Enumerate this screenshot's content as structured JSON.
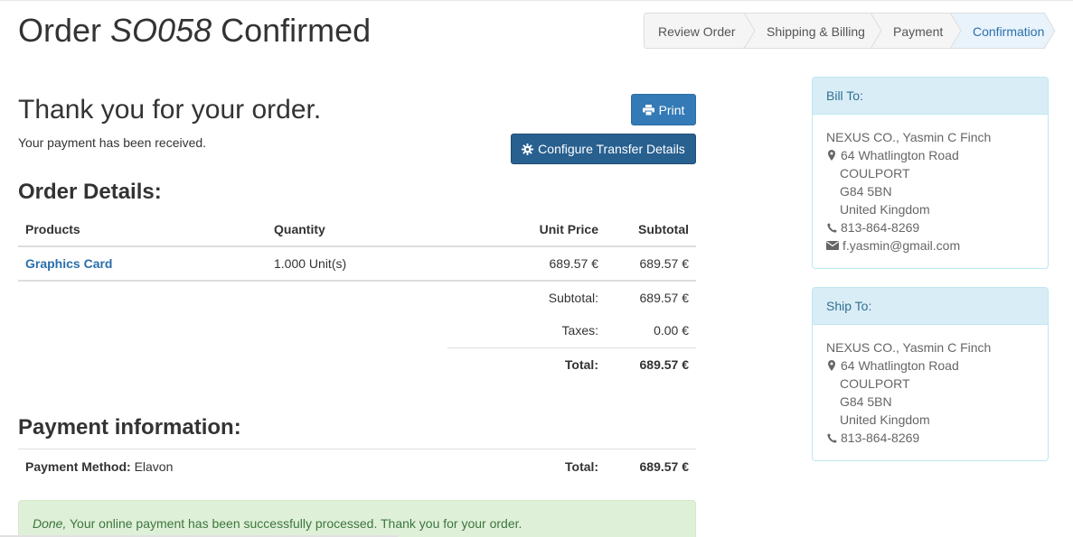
{
  "page": {
    "title_prefix": "Order ",
    "order_number": "SO058",
    "title_suffix": " Confirmed"
  },
  "wizard": {
    "steps": [
      {
        "label": "Review Order"
      },
      {
        "label": "Shipping & Billing"
      },
      {
        "label": "Payment"
      },
      {
        "label": "Confirmation"
      }
    ]
  },
  "thanks": {
    "heading": "Thank you for your order.",
    "message": "Your payment has been received."
  },
  "buttons": {
    "print_label": "Print",
    "configure_label": "Configure Transfer Details"
  },
  "order_details": {
    "heading": "Order Details:",
    "columns": {
      "products": "Products",
      "quantity": "Quantity",
      "unit_price": "Unit Price",
      "subtotal": "Subtotal"
    },
    "items": [
      {
        "product": "Graphics Card",
        "quantity": "1.000 Unit(s)",
        "unit_price": "689.57 €",
        "subtotal": "689.57 €"
      }
    ],
    "summary": {
      "subtotal_label": "Subtotal:",
      "subtotal_value": "689.57 €",
      "taxes_label": "Taxes:",
      "taxes_value": "0.00 €",
      "total_label": "Total:",
      "total_value": "689.57 €"
    }
  },
  "payment": {
    "heading": "Payment information:",
    "method_label": "Payment Method:",
    "method_value": " Elavon",
    "total_label": "Total:",
    "total_value": "689.57 €"
  },
  "alert": {
    "done": "Done,",
    "message": " Your online payment has been successfully processed. Thank you for your order."
  },
  "bill_to": {
    "title": "Bill To:",
    "name": "NEXUS CO., Yasmin C Finch",
    "street": "64 Whatlington Road",
    "city": "COULPORT",
    "zip": "G84 5BN",
    "country": "United Kingdom",
    "phone": "813-864-8269",
    "email": "f.yasmin@gmail.com"
  },
  "ship_to": {
    "title": "Ship To:",
    "name": "NEXUS CO., Yasmin C Finch",
    "street": "64 Whatlington Road",
    "city": "COULPORT",
    "zip": "G84 5BN",
    "country": "United Kingdom",
    "phone": "813-864-8269"
  },
  "colors": {
    "link": "#2a6fac",
    "primary_button": "#337ab7",
    "dark_button": "#286090",
    "panel_heading_bg": "#d9edf7",
    "success_bg": "#dff0d8",
    "wizard_active_bg": "#e9f3fb"
  },
  "icons": {
    "print": "print-icon",
    "configure": "gear-icon",
    "address": "map-marker-icon",
    "phone": "phone-icon",
    "email": "envelope-icon"
  }
}
